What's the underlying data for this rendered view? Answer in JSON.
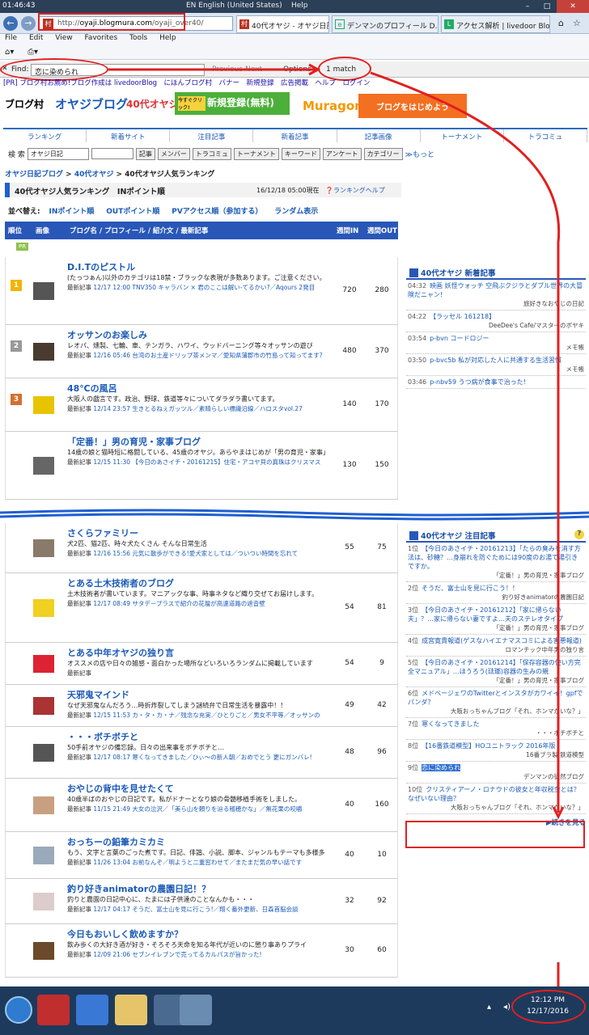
{
  "titlebar": {
    "time": "01:46:43",
    "language": "EN English (United States)",
    "help": "Help"
  },
  "browser": {
    "url_prefix": "http://",
    "url_domain": "oyaji.blogmura.com",
    "url_path": "/oyaji_over40/",
    "tabs": [
      "40代オヤジ - オヤジ日記...",
      "デンマンのプロフィール D...",
      "アクセス解析 | livedoor Blog"
    ],
    "menu": [
      "File",
      "Edit",
      "View",
      "Favorites",
      "Tools",
      "Help"
    ]
  },
  "findbar": {
    "label": "Find:",
    "query": "恋に染められ",
    "previous": "Previous",
    "next": "Next",
    "options": "Options",
    "count": "1 match"
  },
  "site": {
    "toplinks": "[PR] ブログ村お薦め!ブログ作成は livedoorBlog　にほんブログ村　バナー　新規登録　広告掲載　ヘルプ　ログイン",
    "logo_main": "ブログ村",
    "logo_oyaji": "オヤジブログ",
    "logo_40": "40代オヤジ",
    "register_btn": "新規登録(無料)",
    "register_small": "今すぐクリック!",
    "muragon": "Muragon",
    "start_blog": "ブログをはじめよう",
    "navtabs": [
      "ランキング",
      "新着サイト",
      "注目記事",
      "新着記事",
      "記事画像",
      "トーナメント",
      "トラコミュ"
    ],
    "search_label": "検 索",
    "search_select": "オヤジ日記",
    "search_buttons": [
      "記事",
      "メンバー",
      "トラコミュ",
      "トーナメント",
      "キーワード",
      "アンケート",
      "カテゴリー"
    ],
    "search_more": "≫もっと",
    "breadcrumb": [
      "オヤジ日記ブログ",
      "40代オヤジ",
      "40代オヤジ人気ランキング"
    ],
    "rank_title": "40代オヤジ人気ランキング　INポイント順",
    "rank_timestamp": "16/12/18 05:00現在",
    "rank_help": "ランキングヘルプ",
    "sort_label": "並べ替え:",
    "sort_options": [
      "INポイント順",
      "OUTポイント順",
      "PVアクセス順（参加する）",
      "ランダム表示"
    ],
    "table_headers": [
      "順位",
      "画像",
      "ブログ名 / プロフィール / 紹介文 / 最新記事",
      "週間IN",
      "週間OUT"
    ],
    "pr_badge": "PR",
    "rows_top": [
      {
        "rank": "1位",
        "title": "D.I.Tのピストル",
        "desc": "(たっつぁん)以外のカテゴリは18禁・ブラックな表現が多数あります。ご注意ください。",
        "latest": "12/17 12:00 TNV350 キャラバン × 君のここは解い-てるかい?／Aqours 2発目",
        "in": "720",
        "out": "280"
      },
      {
        "rank": "2位",
        "title": "オッサンのお楽しみ",
        "desc": "レオパ、燻製、七輪、車、テンガラ、ハワイ、ウッドバーニング等々オッサンの遊び",
        "latest": "12/16 05:46 台湾のお土産ドリップ茶メンマ／愛知県蒲郡市の竹島って知ってます?",
        "in": "480",
        "out": "370"
      },
      {
        "rank": "3位",
        "title": "48℃の風呂",
        "desc": "大阪人の戯言です。政治、野球、鉄道等々についてダラダラ書いてます。",
        "latest": "12/14 23:57 生きとるねぇガッツル／素晴らしい標識沿線／ハロスタvol.27",
        "in": "140",
        "out": "170"
      },
      {
        "rank": "4位",
        "title": "「定番！」男の育児・家事ブログ",
        "desc": "14歳の娘と猫時短に格闘している、45歳のオヤジ。あらやまはじめが「男の育児・家事」",
        "latest": "12/15 11:30 【今日のあさイチ・20161215】住宅・アコヤ貝の真珠はクリスマス",
        "in": "130",
        "out": "150"
      }
    ],
    "rows_bottom": [
      {
        "rank": "17位",
        "title": "さくらファミリー",
        "desc": "犬2匹、猫2匹、時々犬たくさん そんな日常生活",
        "latest": "12/16 15:56 元気に散歩ができる!愛犬家としては／ついつい時間を忘れて",
        "in": "55",
        "out": "75"
      },
      {
        "rank": "18位",
        "title": "とある土木技術者のブログ",
        "desc": "土木技術者が書いています。マニアックな事、時事ネタなど織り交ぜてお届けします。",
        "latest": "12/17 08:49 サタデープラスで紹介の花壇が高速道路の遮音壁",
        "in": "54",
        "out": "81"
      },
      {
        "rank": "19位",
        "title": "とある中年オヤジの独り言",
        "desc": "オススメの店や日々の雑感・面白かった場所などいろいろランダムに掲載しています",
        "latest": "",
        "in": "54",
        "out": "9"
      },
      {
        "rank": "20位",
        "title": "天邪鬼マインド",
        "desc": "なぜ天邪鬼なんだろう…時折炸裂してしまう謎続弁で日常生活を暴露中！！",
        "latest": "12/15 11:53 カ・タ・カ・ナ／残念な充実／ひとりごと／男女不平等／オッサンの",
        "in": "49",
        "out": "42"
      },
      {
        "rank": "21位",
        "title": "・・・ボチボチと",
        "desc": "50手前オヤジの備忘録。日々の出来事をボチボチと…",
        "latest": "12/17 08:17 寒くなってきました／ひぃ〜の新人朝／おめでとう 更にガンバレ!",
        "in": "48",
        "out": "96"
      },
      {
        "rank": "22位",
        "title": "おやじの背中を見せたくて",
        "desc": "40歳半ばのおやじの日記です。私がドナーとなり娘の骨髄移植手術をしました。",
        "latest": "11/15 21:49 大女の泣沢／「美ら山を頼りを辿る稽穂かな」／無花果の咬嚼",
        "in": "40",
        "out": "160"
      },
      {
        "rank": "23位",
        "title": "おっちーの鉛筆カミカミ",
        "desc": "もう、文字と言葉のごった煮です。日記、俳諧、小説、脚本、ジャンルもテーマも多様多",
        "latest": "11/26 13:04 お前なんぞ／明ようと二重窓わせて／またまだ気の早い話です",
        "in": "40",
        "out": "10"
      },
      {
        "rank": "24位",
        "title": "釣り好きanimatorの農園日記！？",
        "desc": "釣りと農園の日記中心に、たまには子供達のことなんかも・・・",
        "latest": "12/17 04:17 そうだ、富士山を見に行こう!／翔く番外更新、日森首脳会談",
        "in": "32",
        "out": "92"
      },
      {
        "rank": "25位",
        "title": "今日もおいしく飲めますか？",
        "desc": "飲み歩くの大好き酒が好き・そろそろ天命を知る年代が近いのに懲り事ありプライ",
        "latest": "12/09 21:06 セブンイレブンで売ってるカルパスが旨かった!",
        "in": "30",
        "out": "60"
      }
    ],
    "side_new": {
      "title": "40代オヤジ 新着記事",
      "items": [
        {
          "time": "04:32",
          "title": "映画 妖怪ウォッチ 空飛ぶクジラとダブル世界の大冒険だニャン!",
          "src": "旅好きなおやじの日記"
        },
        {
          "time": "04:22",
          "title": "【ラッセル 161218】",
          "src": "DeeDee's Cafe/マスターのボヤキ"
        },
        {
          "time": "03:54",
          "title": "p-bvn コードロジー",
          "src": "メモ帳"
        },
        {
          "time": "03:50",
          "title": "p-bvc5b 私が対応した人に共通する生活習慣",
          "src": "メモ帳"
        },
        {
          "time": "03:46",
          "title": "p-nbv59 うつ病が食事で治った！",
          "src": ""
        }
      ]
    },
    "side_hot": {
      "title": "40代オヤジ 注目記事",
      "more": "続きを見る",
      "items": [
        {
          "rank": "1位",
          "title": "【今日のあさイチ・20161213】「たらの臭みを消す方法は、砂糖？…身崩れを防ぐためには90度のお湯で湯引きですか。",
          "src": "「定番！」男の育児・家事ブログ"
        },
        {
          "rank": "2位",
          "title": "そうだ、富士山を見に行こう！！",
          "src": "釣り好きanimatorの農園日記"
        },
        {
          "rank": "3位",
          "title": "【今日のあさイチ・20161212】「家に帰らない夫」？…家に帰らない妻ですよ…夫のステレオタイプ",
          "src": "「定番！」男の育児・家事ブログ"
        },
        {
          "rank": "4位",
          "title": "成宮寛貴報道(ゲスなハイエナマスコミによる害悪報道)",
          "src": "ロマンチック中年男の独り言"
        },
        {
          "rank": "5位",
          "title": "【今日のあさイチ・20161214】「保存容器の使い方完全マニュアル」…ほうろう(琺瑯)容器の生みの親",
          "src": "「定番！」男の育児・家事ブログ"
        },
        {
          "rank": "6位",
          "title": "メドベージェワのTwitterとインスタがカワイイ！gpfでパンダ？",
          "src": "大阪おっちゃんブログ「それ、ホンマかいな？」"
        },
        {
          "rank": "7位",
          "title": "寒くなってきました",
          "src": "・・・ボチボチと"
        },
        {
          "rank": "8位",
          "title": "【16番鉄道模型】HOユニトラック 2016年版",
          "src": "16番ブラ製 鉄道模型"
        },
        {
          "rank": "9位",
          "title": "恋に染められ",
          "src": "デンマンの徒然ブログ"
        },
        {
          "rank": "10位",
          "title": "クリスティアーノ・ロナウドの彼女と年収税金とは？なぜいない理由？",
          "src": "大阪おっちゃんブログ「それ、ホンマかいな？」"
        }
      ]
    }
  },
  "taskbar": {
    "clock_time": "12:12 PM",
    "clock_date": "12/17/2016"
  },
  "colors": {
    "accent_blue": "#2957b8",
    "annotation_red": "#e02020",
    "find_highlight": "#2f6fd0"
  }
}
